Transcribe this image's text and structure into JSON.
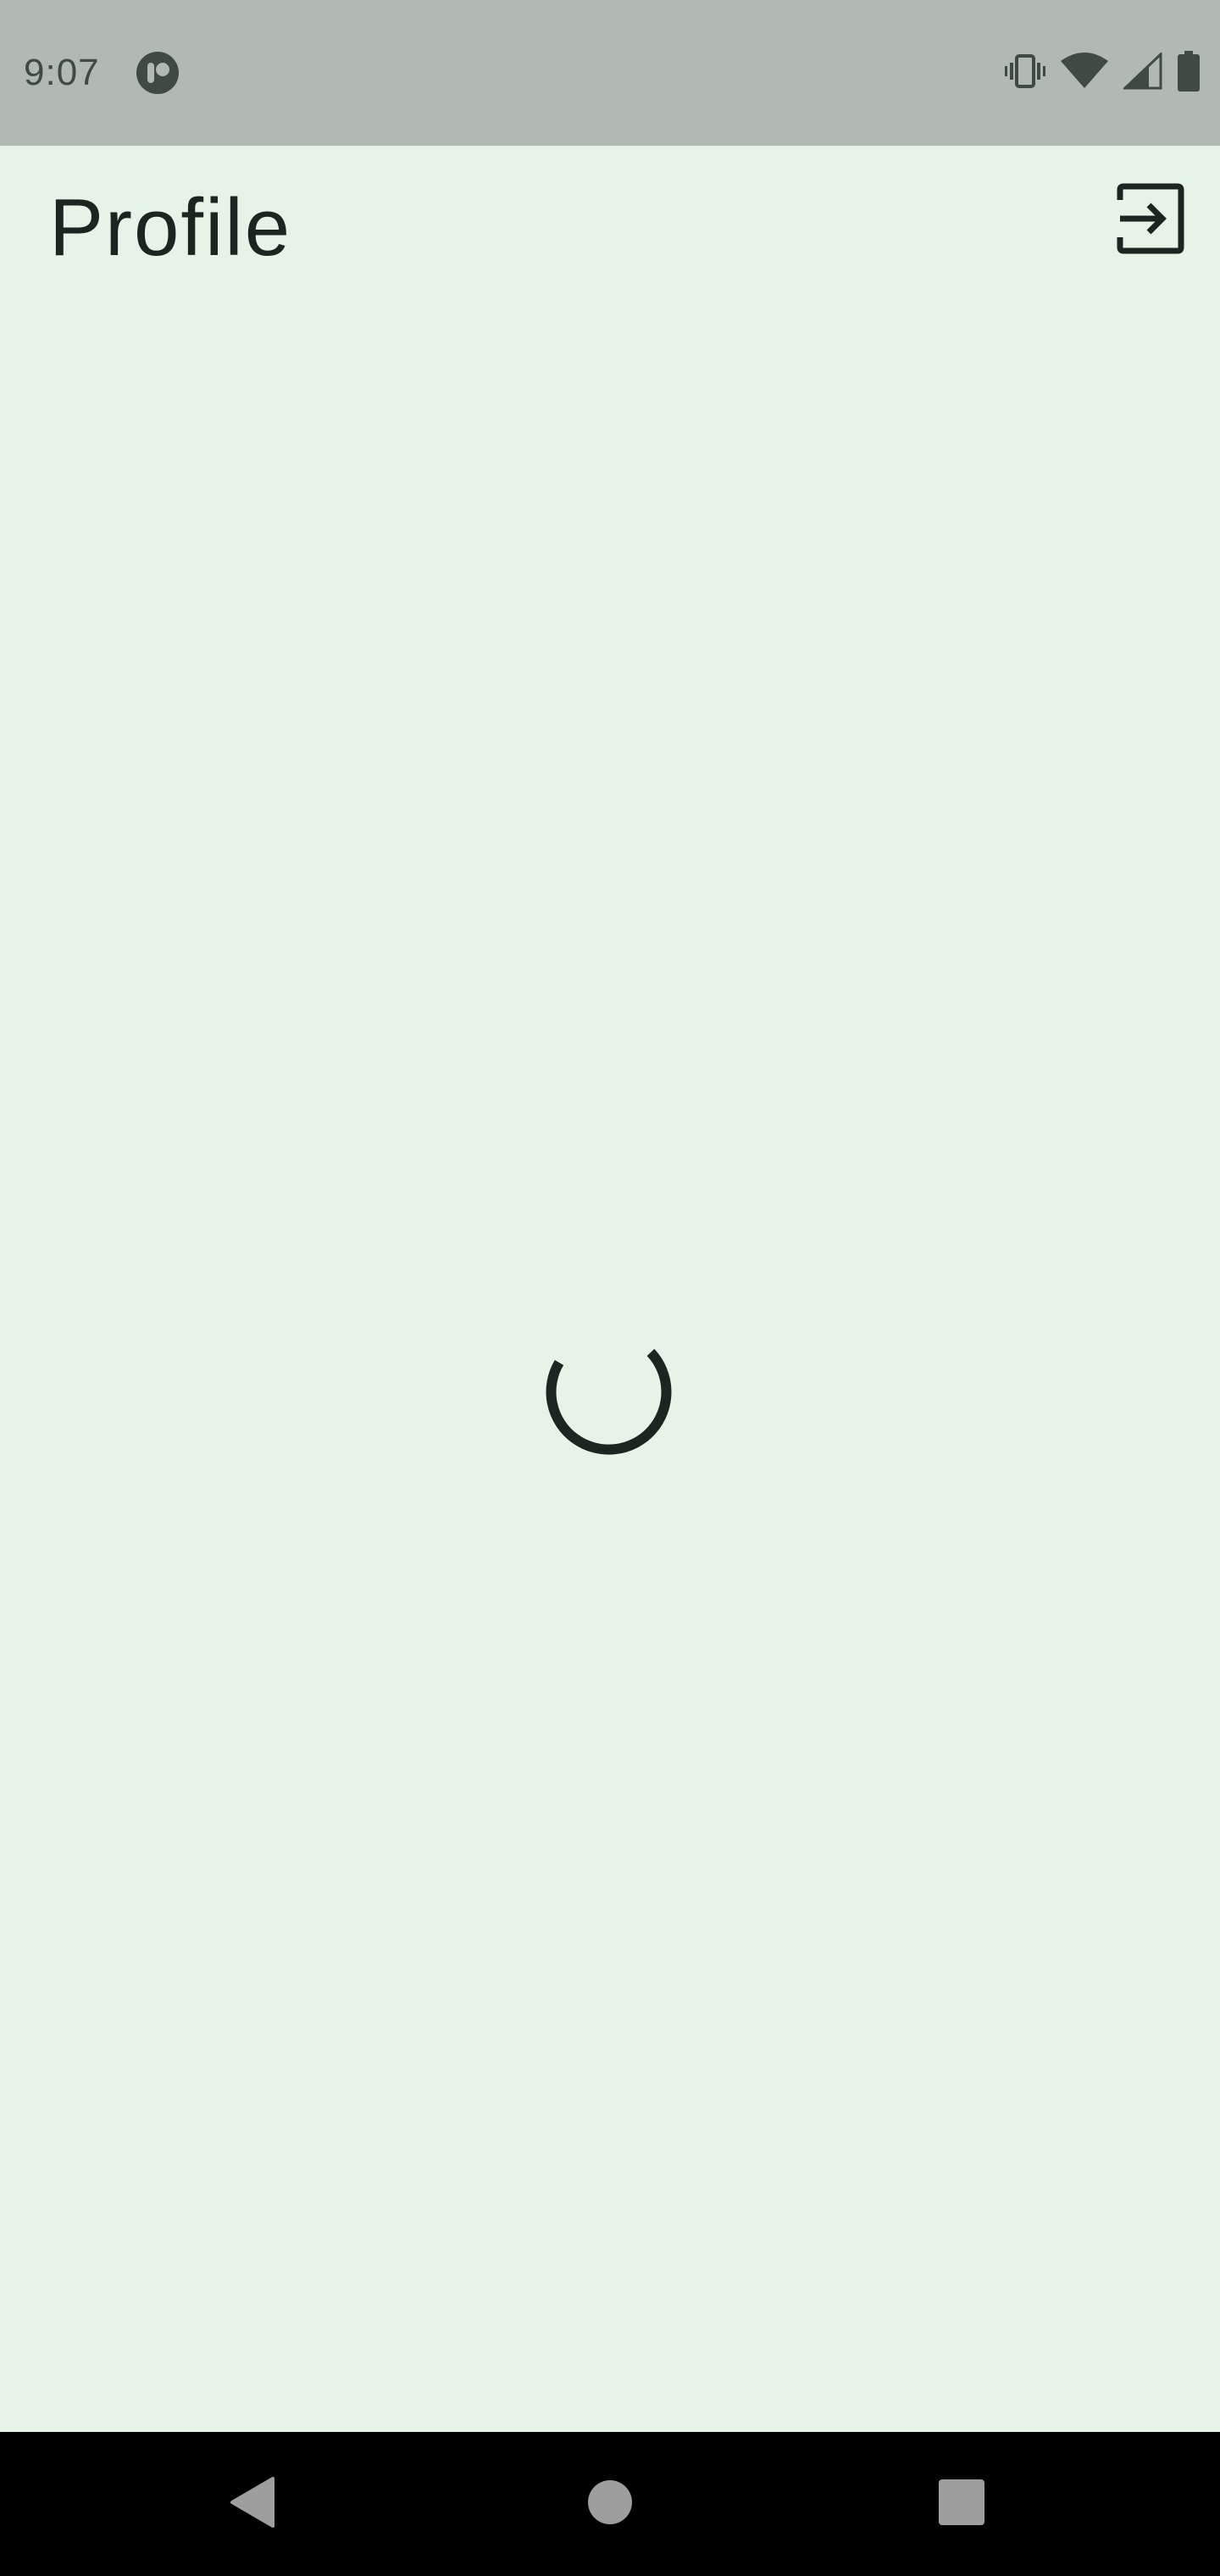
{
  "status_bar": {
    "time": "9:07",
    "icons": [
      "app-notification-icon",
      "vibrate-icon",
      "wifi-icon",
      "cellular-signal-icon",
      "battery-icon"
    ],
    "color": "#b0b9b2"
  },
  "app_bar": {
    "title": "Profile",
    "action_icon": "logout-icon"
  },
  "content": {
    "state": "loading",
    "indicator_icon": "progress-spinner"
  },
  "navigation_bar": {
    "buttons": [
      "back-icon",
      "home-icon",
      "recents-icon"
    ]
  },
  "colors": {
    "background": "#e6f4e8",
    "on_surface": "#1c2620",
    "status_bar": "#b0b9b2",
    "nav_bar": "#000000"
  }
}
